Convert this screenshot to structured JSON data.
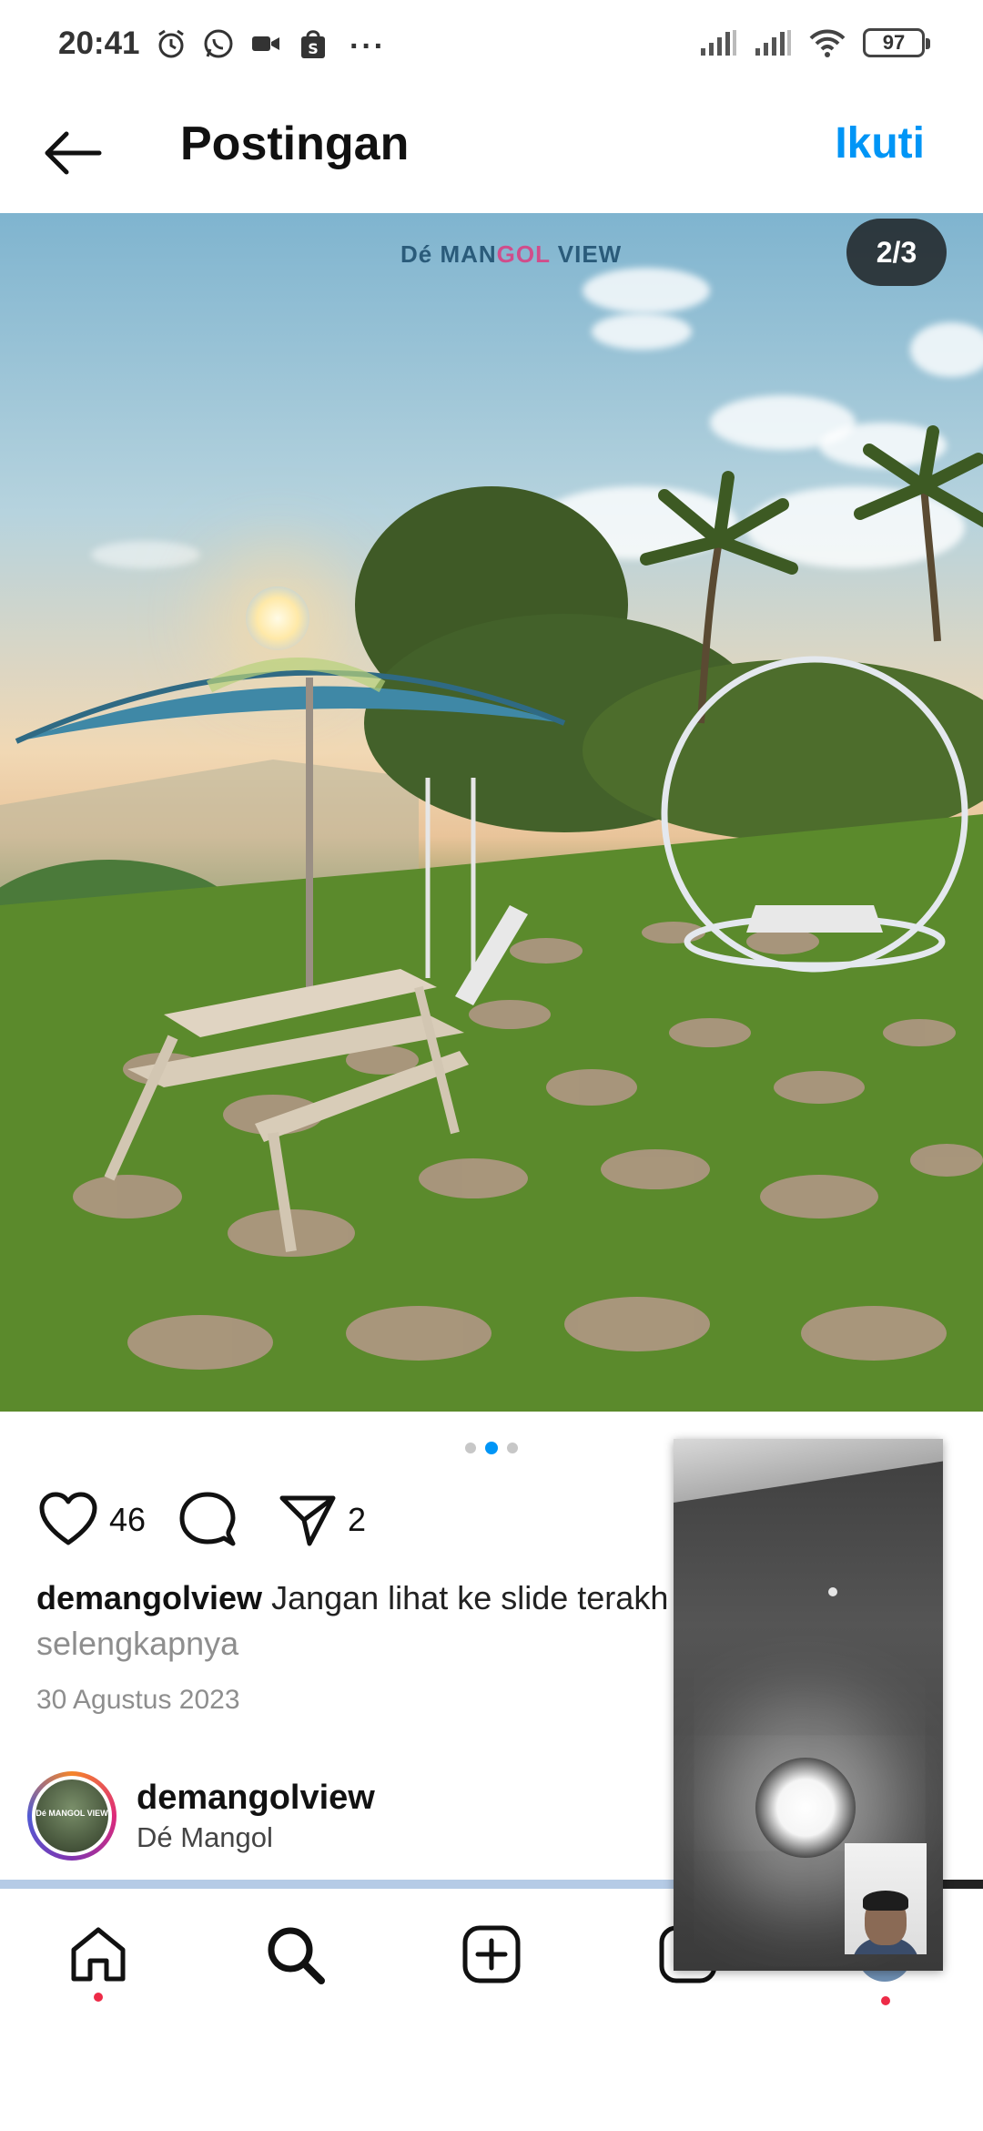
{
  "status_bar": {
    "time": "20:41",
    "battery": "97",
    "more_indicator": "···",
    "left_icons": [
      "alarm-icon",
      "whatsapp-icon",
      "video-camera-icon",
      "shopping-bag-icon"
    ],
    "right_icons": [
      "signal-icon",
      "signal-icon",
      "wifi-icon",
      "battery-icon"
    ]
  },
  "header": {
    "title": "Postingan",
    "follow_label": "Ikuti",
    "back_icon": "arrow-left-icon"
  },
  "post": {
    "brand_logo_prefix": "Dé MAN",
    "brand_logo_accent": "GOL",
    "brand_logo_suffix": " VIEW",
    "page_counter": "2/3",
    "carousel_total": 3,
    "carousel_active": 2,
    "likes": "46",
    "shares": "2",
    "caption_user": "demangolview",
    "caption_text": " Jangan lihat ke slide terakh",
    "caption_more": "selengkapnya",
    "date": "30 Agustus 2023"
  },
  "author": {
    "username": "demangolview",
    "subtitle": "Dé Mangol",
    "avatar_text": "Dé MANGOL VIEW"
  },
  "bottom_nav": {
    "items": [
      "home-icon",
      "search-icon",
      "add-post-icon",
      "reels-icon",
      "profile-icon"
    ]
  },
  "colors": {
    "accent": "#0095f6",
    "notification": "#ed2b47"
  }
}
